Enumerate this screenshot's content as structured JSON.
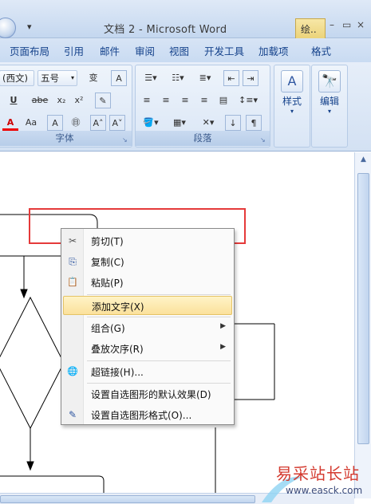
{
  "window": {
    "title": "文档 2 - Microsoft Word",
    "context_tab": "绘..",
    "controls": {
      "minimize": "–",
      "restore": "▭",
      "close": "×"
    },
    "qat_arrow": "▾"
  },
  "tabs": [
    {
      "label": "页面布局"
    },
    {
      "label": "引用"
    },
    {
      "label": "邮件"
    },
    {
      "label": "审阅"
    },
    {
      "label": "视图"
    },
    {
      "label": "开发工具"
    },
    {
      "label": "加载项"
    },
    {
      "label": "格式"
    }
  ],
  "help_label": "?",
  "font_group": {
    "label": "字体",
    "font_name": "(西文)",
    "font_size": "五号",
    "buttons": {
      "wen": "变",
      "a_box": "A",
      "underline": "U",
      "strike": "abe",
      "sub": "x₂",
      "sup": "x²",
      "font_color": "A",
      "aa": "Aa",
      "char_border": "A",
      "enclose": "㊐",
      "grow": "A˄",
      "shrink": "A˅"
    },
    "launcher": "↘"
  },
  "paragraph_group": {
    "label": "段落",
    "launcher": "↘"
  },
  "styles_button": {
    "label": "样式",
    "icon": "A",
    "arrow": "▾"
  },
  "edit_button": {
    "label": "编辑",
    "icon": "🔭",
    "arrow": "▾"
  },
  "context_menu": {
    "items": [
      {
        "label": "剪切(T)",
        "icon": "scissors-icon",
        "glyph": "✂",
        "submenu": false
      },
      {
        "label": "复制(C)",
        "icon": "copy-icon",
        "glyph": "⎘",
        "submenu": false
      },
      {
        "label": "粘贴(P)",
        "icon": "paste-icon",
        "glyph": "📋",
        "submenu": false
      },
      {
        "label": "添加文字(X)",
        "icon": "",
        "glyph": "",
        "submenu": false,
        "highlighted": true
      },
      {
        "label": "组合(G)",
        "icon": "",
        "glyph": "",
        "submenu": true
      },
      {
        "label": "叠放次序(R)",
        "icon": "",
        "glyph": "",
        "submenu": true
      },
      {
        "label": "超链接(H)...",
        "icon": "hyperlink-icon",
        "glyph": "🌐",
        "submenu": false
      },
      {
        "label": "设置自选图形的默认效果(D)",
        "icon": "",
        "glyph": "",
        "submenu": false
      },
      {
        "label": "设置自选图形格式(O)...",
        "icon": "format-shape-icon",
        "glyph": "✎",
        "submenu": false
      }
    ],
    "submenu_arrow": "▶"
  },
  "watermark": {
    "text": "易采站长站",
    "url": "www.easck.com"
  },
  "colors": {
    "highlight_box": "#e53a3a",
    "ribbon_text": "#15428b",
    "menu_highlight": "#fbe19c"
  }
}
